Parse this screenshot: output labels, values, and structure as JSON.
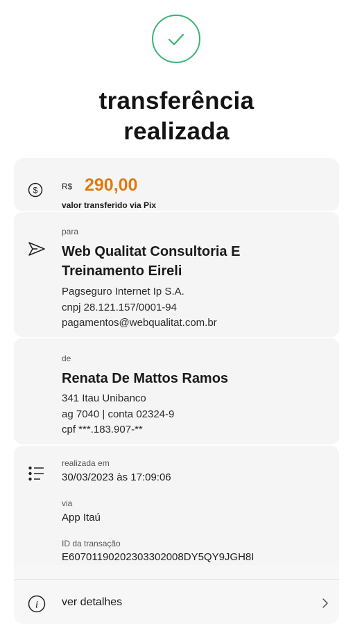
{
  "header": {
    "title_line1": "transferência",
    "title_line2": "realizada",
    "check_icon": "check-circle-icon",
    "accent_color": "#3cb371"
  },
  "amount": {
    "currency": "R$",
    "value": "290,00",
    "subtitle": "valor transferido via Pix",
    "icon": "dollar-circle-icon",
    "value_color": "#e07a13"
  },
  "recipient": {
    "label": "para",
    "name_line1": "Web Qualitat Consultoria E",
    "name_line2": "Treinamento Eireli",
    "institution": " Pagseguro Internet Ip S.A.",
    "document": "cnpj 28.121.157/0001-94",
    "pix_key": "pagamentos@webqualitat.com.br",
    "icon": "send-icon"
  },
  "sender": {
    "label": "de",
    "name": "Renata De Mattos Ramos",
    "bank": "341 Itau Unibanco",
    "account": "ag 7040 | conta 02324-9",
    "document": "cpf ***.183.907-**"
  },
  "transaction": {
    "icon": "list-icon",
    "date_label": "realizada em",
    "date_value": "30/03/2023 às 17:09:06",
    "via_label": "via",
    "via_value": "App Itaú",
    "id_label": "ID da transação",
    "id_value": "E60701190202303302008DY5QY9JGH8I"
  },
  "details_link": {
    "label": "ver detalhes",
    "icon": "info-icon",
    "chevron": "chevron-right-icon"
  }
}
